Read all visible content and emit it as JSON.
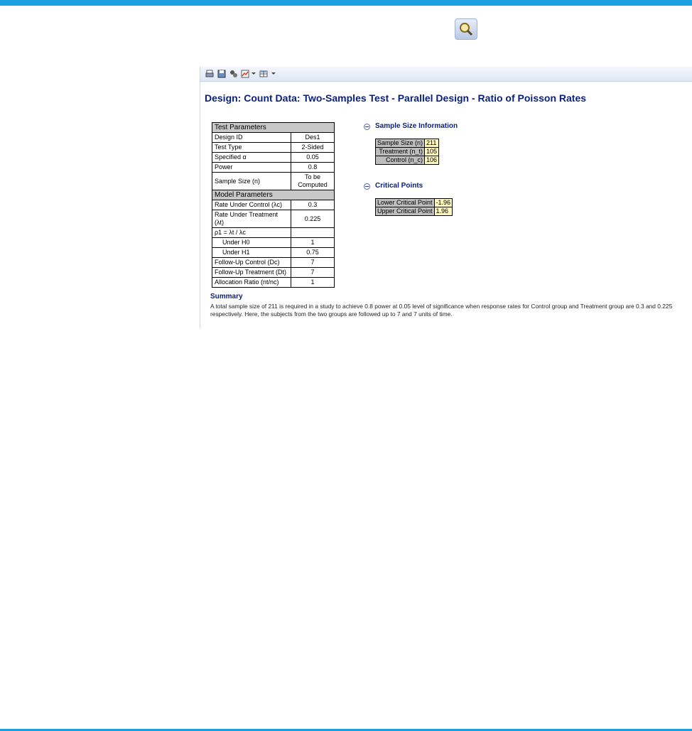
{
  "report": {
    "title": "Design: Count Data: Two-Samples Test - Parallel Design - Ratio of Poisson Rates",
    "test_parameters": {
      "header": "Test Parameters",
      "rows": [
        {
          "label": "Design ID",
          "value": "Des1"
        },
        {
          "label": "Test Type",
          "value": "2-Sided"
        },
        {
          "label": "Specified α",
          "value": "0.05"
        },
        {
          "label": "Power",
          "value": "0.8"
        },
        {
          "label": "Sample Size (n)",
          "value": "To be Computed"
        }
      ]
    },
    "model_parameters": {
      "header": "Model Parameters",
      "rows": [
        {
          "label": "Rate Under Control (λc)",
          "value": "0.3"
        },
        {
          "label": "Rate Under Treatment (λt)",
          "value": "0.225"
        },
        {
          "label": "ρ1 = λt / λc",
          "value": ""
        },
        {
          "label": "Under H0",
          "value": "1"
        },
        {
          "label": "Under H1",
          "value": "0.75"
        },
        {
          "label": "Follow-Up Control (Dc)",
          "value": "7"
        },
        {
          "label": "Follow-Up Treatment (Dt)",
          "value": "7"
        },
        {
          "label": "Allocation Ratio (nt/nc)",
          "value": "1"
        }
      ]
    },
    "sample_size_info": {
      "title": "Sample Size Information",
      "rows": [
        {
          "label": "Sample Size (n)",
          "value": "211"
        },
        {
          "label": "Treatment (n_t)",
          "value": "105"
        },
        {
          "label": "Control (n_c)",
          "value": "106"
        }
      ]
    },
    "critical_points": {
      "title": "Critical Points",
      "rows": [
        {
          "label": "Lower Critical Point",
          "value": "-1.96"
        },
        {
          "label": "Upper Critical Point",
          "value": "1.96"
        }
      ]
    },
    "summary": {
      "title": "Summary",
      "text": "A total sample size of 211 is required in a study to achieve 0.8 power at 0.05 level of significance when response rates for Control group and Treatment group are 0.3 and 0.225 respectively. Here, the subjects from the two groups are followed up to 7 and 7 units of time."
    }
  },
  "icons": {
    "top": "magnifier-icon",
    "toolbar": [
      "print-icon",
      "save-icon",
      "settings-icon",
      "chart-icon",
      "table-icon"
    ]
  },
  "colors": {
    "accent": "#1ba1e2",
    "title": "#0a1f7a",
    "value_highlight": "#fff8c0",
    "label_gray": "#bdbdbd"
  }
}
